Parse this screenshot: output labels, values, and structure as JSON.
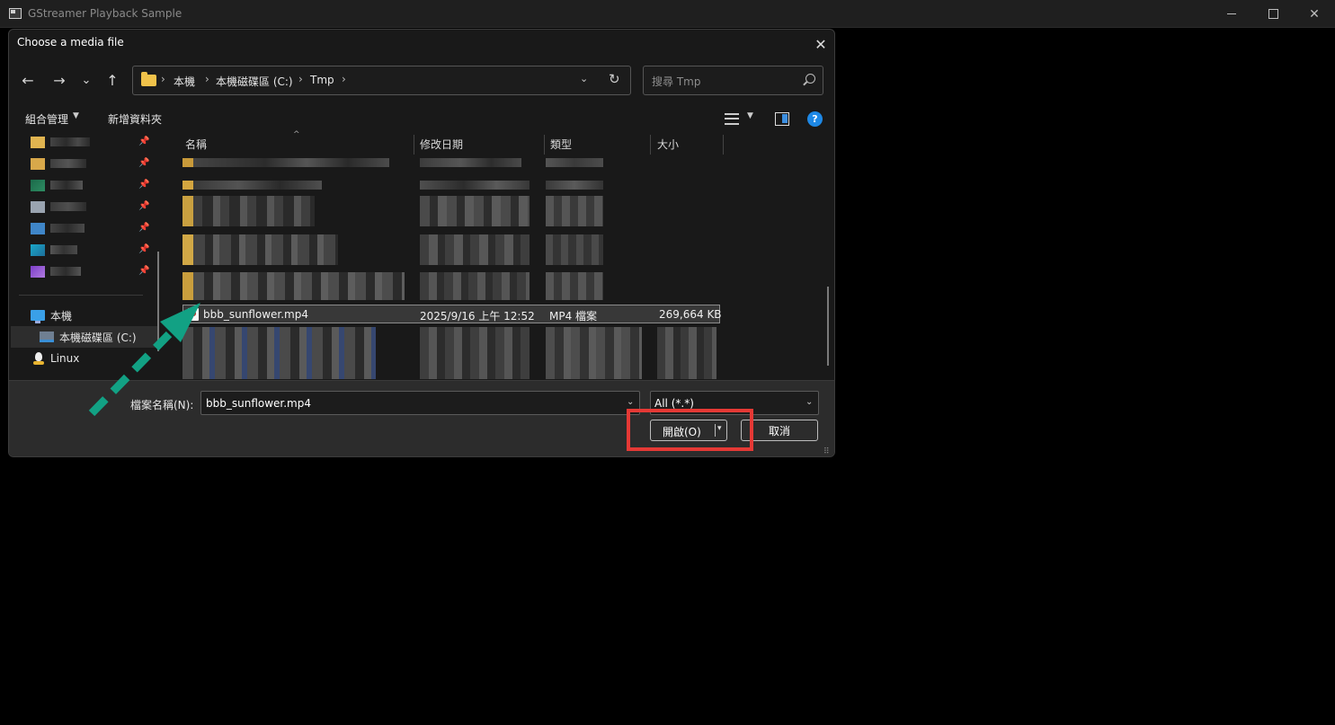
{
  "app": {
    "title": "GStreamer Playback Sample",
    "minimize_icon": "minimize-icon",
    "maximize_icon": "maximize-icon",
    "close_icon": "close-icon"
  },
  "dialog": {
    "title": "Choose a media file",
    "close": "✕",
    "nav": {
      "back": "←",
      "forward": "→",
      "recent": "⌄",
      "up": "↑"
    },
    "address": {
      "crumbs": [
        "本機",
        "本機磁碟區 (C:)",
        "Tmp"
      ],
      "separator": "›",
      "dropdown": "⌄",
      "refresh": "↻"
    },
    "search_placeholder": "搜尋 Tmp",
    "toolbar": {
      "organize": "組合管理",
      "new_folder": "新增資料夾",
      "caret": "▼",
      "help": "?"
    },
    "columns": {
      "name": "名稱",
      "date": "修改日期",
      "type": "類型",
      "size": "大小",
      "sort": "^"
    },
    "selected_file": {
      "name": "bbb_sunflower.mp4",
      "date": "2025/9/16 上午 12:52",
      "type": "MP4 檔案",
      "size": "269,664 KB"
    },
    "nav_tree": {
      "pc": "本機",
      "drive": "本機磁碟區 (C:)",
      "linux": "Linux",
      "pin": "📌"
    },
    "bottom": {
      "filename_label": "檔案名稱(N):",
      "filename_value": "bbb_sunflower.mp4",
      "filetype_value": "All (*.*)",
      "open_button": "開啟(O)",
      "cancel_button": "取消",
      "dropdown": "⌄",
      "split_caret": "▾",
      "grip": "⠿"
    }
  },
  "colors": {
    "annotation_box": "#e53935",
    "annotation_arrow": "#12a184",
    "accent": "#1e88e5"
  }
}
